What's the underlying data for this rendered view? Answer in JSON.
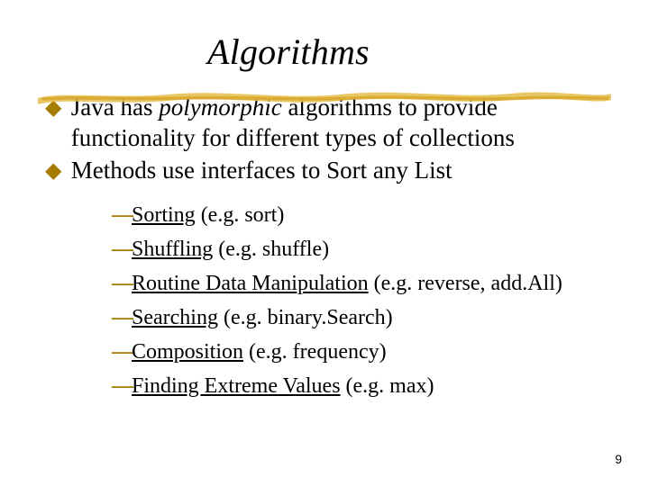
{
  "title": "Algorithms",
  "top_points": [
    {
      "pre": "Java has ",
      "italic": "polymorphic",
      "post": " algorithms to provide functionality for different types of collections"
    },
    {
      "pre": "Methods use interfaces to Sort any List",
      "italic": "",
      "post": ""
    }
  ],
  "sub_points": [
    {
      "link": "Sorting",
      "rest": "  (e.g. sort)"
    },
    {
      "link": "Shuffling",
      "rest": "  (e.g. shuffle)"
    },
    {
      "link": "Routine Data Manipulation",
      "rest": "  (e.g. reverse, add.All)"
    },
    {
      "link": "Searching",
      "rest": " (e.g. binary.Search)"
    },
    {
      "link": "Composition",
      "rest": " (e.g. frequency)"
    },
    {
      "link": "Finding Extreme Values",
      "rest": "  (e.g. max)"
    }
  ],
  "page_number": "9"
}
